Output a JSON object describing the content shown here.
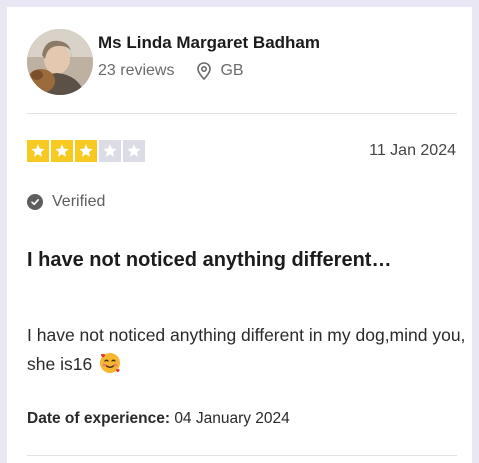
{
  "reviewer": {
    "name": "Ms Linda Margaret Badham",
    "reviews_count": "23 reviews",
    "location": "GB",
    "location_icon": "location-pin-icon",
    "avatar_icon": "user-avatar-photo"
  },
  "review": {
    "rating": 3,
    "rating_max": 5,
    "rating_color": "#f8c921",
    "date": "11 Jan 2024",
    "verified_label": "Verified",
    "title": "I have not noticed anything different…",
    "body": "I have not noticed anything different in my dog,mind you, she is16",
    "emoji": "smiling-face-with-hearts-emoji",
    "experience_label": "Date of experience:",
    "experience_date": "04 January 2024"
  }
}
